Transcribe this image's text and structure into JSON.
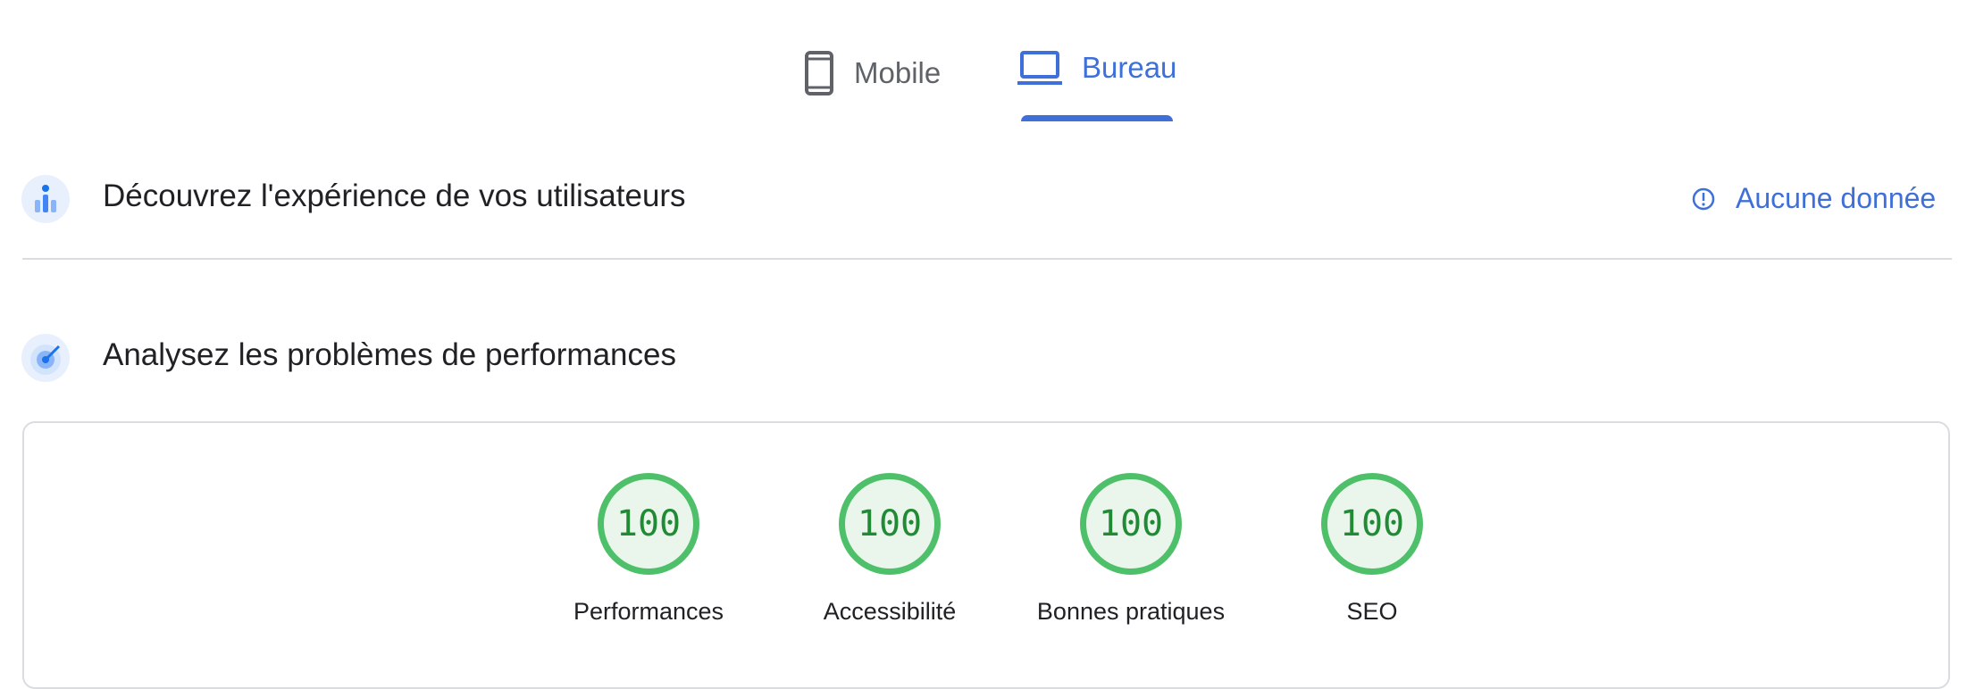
{
  "tabs": [
    {
      "label": "Mobile",
      "icon": "phone-icon",
      "active": false
    },
    {
      "label": "Bureau",
      "icon": "laptop-icon",
      "active": true
    }
  ],
  "sections": {
    "field_data": {
      "title": "Découvrez l'expérience de vos utilisateurs",
      "icon": "users-chart-icon",
      "status_text": "Aucune donnée",
      "status_icon": "info-icon"
    },
    "lab_data": {
      "title": "Analysez les problèmes de performances",
      "icon": "radar-icon"
    }
  },
  "scores": [
    {
      "value": "100",
      "label": "Performances"
    },
    {
      "value": "100",
      "label": "Accessibilité"
    },
    {
      "value": "100",
      "label": "Bonnes pratiques"
    },
    {
      "value": "100",
      "label": "SEO"
    }
  ],
  "colors": {
    "accent": "#3f6fd8",
    "pass": "#4fc06a",
    "pass_text": "#208a35"
  }
}
